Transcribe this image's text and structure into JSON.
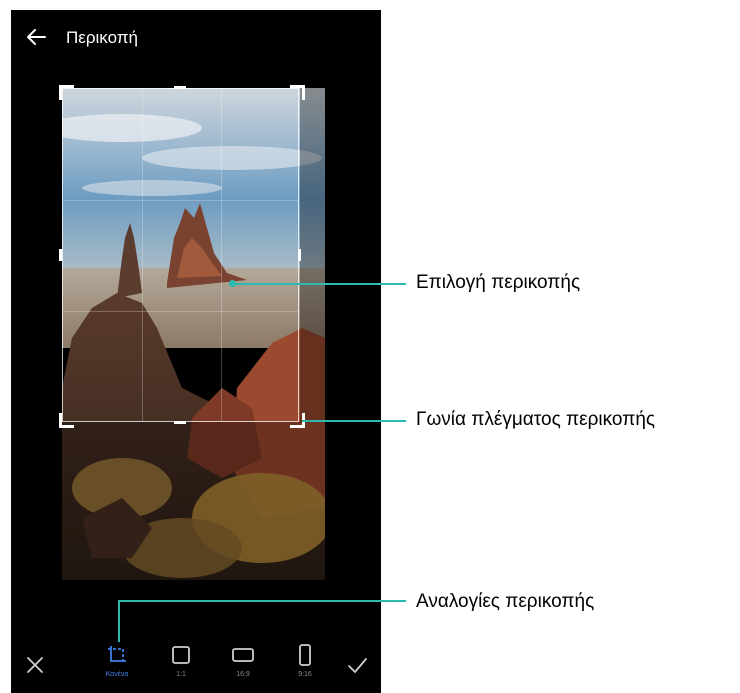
{
  "header": {
    "title": "Περικοπή"
  },
  "toolbar": {
    "ratios": [
      {
        "label": "Κανένα",
        "active": true,
        "icon": "free-crop-icon"
      },
      {
        "label": "1:1",
        "active": false,
        "icon": "square-ratio-icon"
      },
      {
        "label": "16:9",
        "active": false,
        "icon": "landscape-ratio-icon"
      },
      {
        "label": "9:16",
        "active": false,
        "icon": "portrait-ratio-icon"
      }
    ]
  },
  "callouts": {
    "crop_selection": "Επιλογή περικοπής",
    "grid_corner": "Γωνία πλέγματος περικοπής",
    "crop_ratios": "Αναλογίες περικοπής"
  },
  "colors": {
    "callout_line": "#2bb9b0",
    "accent": "#3f7fe8"
  }
}
